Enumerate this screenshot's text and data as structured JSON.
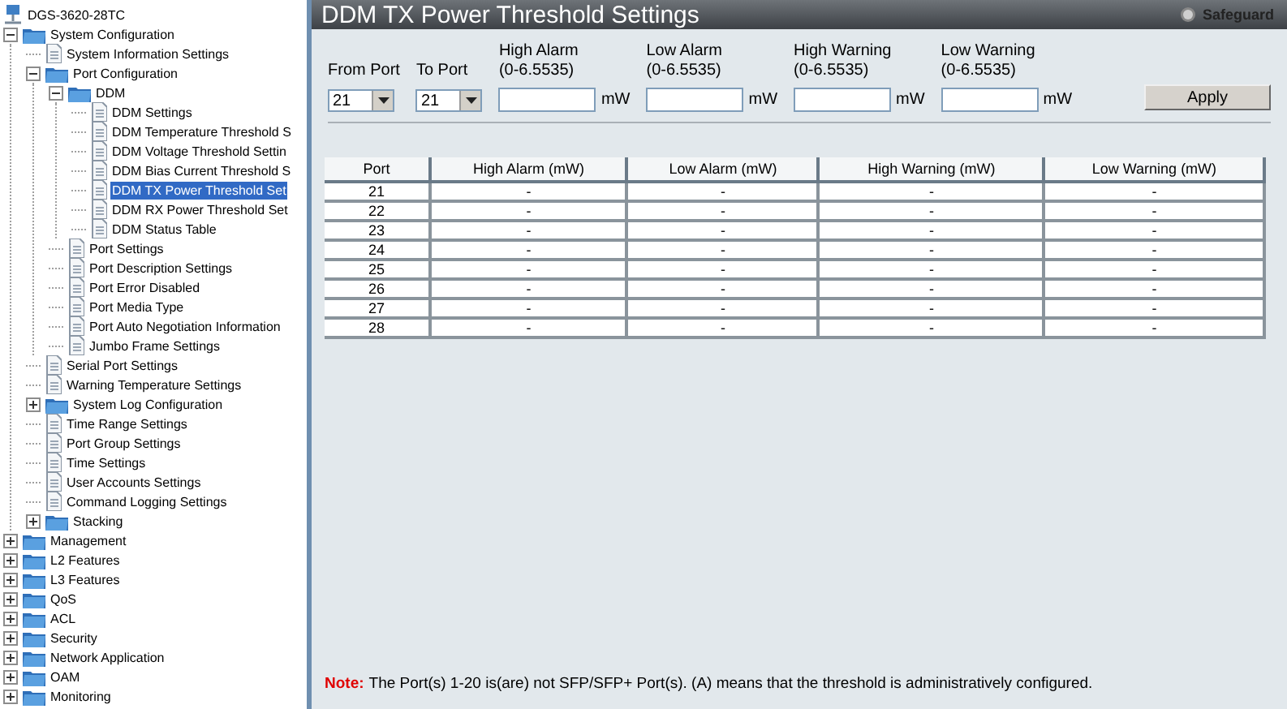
{
  "tree": {
    "label": "DGS-3620-28TC",
    "kind": "device",
    "children": [
      {
        "label": "System Configuration",
        "kind": "folder",
        "expanded": true,
        "selected": false,
        "children": [
          {
            "label": "System Information Settings",
            "kind": "page",
            "selected": false
          },
          {
            "label": "Port Configuration",
            "kind": "folder",
            "expanded": true,
            "selected": false,
            "children": [
              {
                "label": "DDM",
                "kind": "folder",
                "expanded": true,
                "selected": false,
                "children": [
                  {
                    "label": "DDM Settings",
                    "kind": "page",
                    "selected": false
                  },
                  {
                    "label": "DDM Temperature Threshold S",
                    "kind": "page",
                    "selected": false
                  },
                  {
                    "label": "DDM Voltage Threshold Settin",
                    "kind": "page",
                    "selected": false
                  },
                  {
                    "label": "DDM Bias Current Threshold S",
                    "kind": "page",
                    "selected": false
                  },
                  {
                    "label": "DDM TX Power Threshold Set",
                    "kind": "page",
                    "selected": true
                  },
                  {
                    "label": "DDM RX Power Threshold Set",
                    "kind": "page",
                    "selected": false
                  },
                  {
                    "label": "DDM Status Table",
                    "kind": "page",
                    "selected": false
                  }
                ]
              },
              {
                "label": "Port Settings",
                "kind": "page",
                "selected": false
              },
              {
                "label": "Port Description Settings",
                "kind": "page",
                "selected": false
              },
              {
                "label": "Port Error Disabled",
                "kind": "page",
                "selected": false
              },
              {
                "label": "Port Media Type",
                "kind": "page",
                "selected": false
              },
              {
                "label": "Port Auto Negotiation Information",
                "kind": "page",
                "selected": false
              },
              {
                "label": "Jumbo Frame Settings",
                "kind": "page",
                "selected": false
              }
            ]
          },
          {
            "label": "Serial Port Settings",
            "kind": "page",
            "selected": false
          },
          {
            "label": "Warning Temperature Settings",
            "kind": "page",
            "selected": false
          },
          {
            "label": "System Log Configuration",
            "kind": "folder",
            "expanded": false,
            "selected": false
          },
          {
            "label": "Time Range Settings",
            "kind": "page",
            "selected": false
          },
          {
            "label": "Port Group Settings",
            "kind": "page",
            "selected": false
          },
          {
            "label": "Time Settings",
            "kind": "page",
            "selected": false
          },
          {
            "label": "User Accounts Settings",
            "kind": "page",
            "selected": false
          },
          {
            "label": "Command Logging Settings",
            "kind": "page",
            "selected": false
          },
          {
            "label": "Stacking",
            "kind": "folder",
            "expanded": false,
            "selected": false
          }
        ]
      },
      {
        "label": "Management",
        "kind": "folder",
        "expanded": false,
        "selected": false
      },
      {
        "label": "L2 Features",
        "kind": "folder",
        "expanded": false,
        "selected": false
      },
      {
        "label": "L3 Features",
        "kind": "folder",
        "expanded": false,
        "selected": false
      },
      {
        "label": "QoS",
        "kind": "folder",
        "expanded": false,
        "selected": false
      },
      {
        "label": "ACL",
        "kind": "folder",
        "expanded": false,
        "selected": false
      },
      {
        "label": "Security",
        "kind": "folder",
        "expanded": false,
        "selected": false
      },
      {
        "label": "Network Application",
        "kind": "folder",
        "expanded": false,
        "selected": false
      },
      {
        "label": "OAM",
        "kind": "folder",
        "expanded": false,
        "selected": false
      },
      {
        "label": "Monitoring",
        "kind": "folder",
        "expanded": false,
        "selected": false
      }
    ]
  },
  "page": {
    "title": "DDM TX Power Threshold Settings",
    "safeguard": "Safeguard"
  },
  "form": {
    "from_port": {
      "label": "From Port",
      "value": "21"
    },
    "to_port": {
      "label": "To Port",
      "value": "21"
    },
    "thresholds": [
      {
        "label": "High Alarm",
        "range": "(0-6.5535)",
        "unit": "mW"
      },
      {
        "label": "Low Alarm",
        "range": "(0-6.5535)",
        "unit": "mW"
      },
      {
        "label": "High Warning",
        "range": "(0-6.5535)",
        "unit": "mW"
      },
      {
        "label": "Low Warning",
        "range": "(0-6.5535)",
        "unit": "mW"
      }
    ],
    "apply": "Apply"
  },
  "table": {
    "columns": [
      "Port",
      "High Alarm (mW)",
      "Low Alarm (mW)",
      "High Warning (mW)",
      "Low Warning (mW)"
    ],
    "rows": [
      [
        "21",
        "-",
        "-",
        "-",
        "-"
      ],
      [
        "22",
        "-",
        "-",
        "-",
        "-"
      ],
      [
        "23",
        "-",
        "-",
        "-",
        "-"
      ],
      [
        "24",
        "-",
        "-",
        "-",
        "-"
      ],
      [
        "25",
        "-",
        "-",
        "-",
        "-"
      ],
      [
        "26",
        "-",
        "-",
        "-",
        "-"
      ],
      [
        "27",
        "-",
        "-",
        "-",
        "-"
      ],
      [
        "28",
        "-",
        "-",
        "-",
        "-"
      ]
    ]
  },
  "note": {
    "label": "Note:",
    "text": "The Port(s) 1-20 is(are) not SFP/SFP+ Port(s). (A) means that the threshold is administratively configured."
  }
}
